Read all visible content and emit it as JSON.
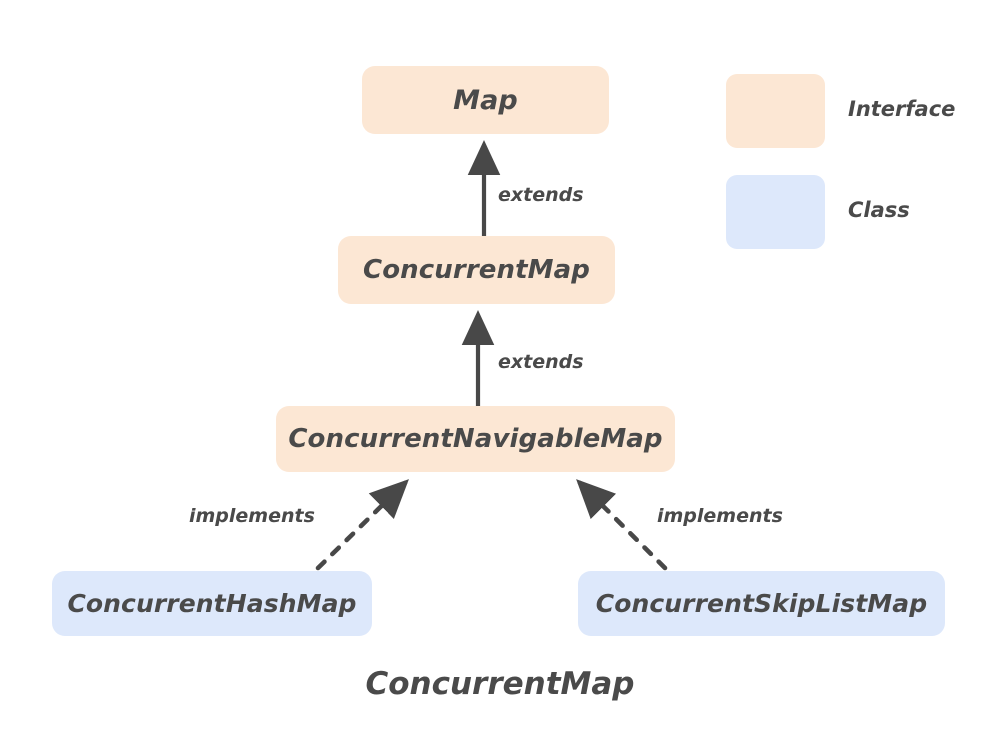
{
  "diagram": {
    "caption": "ConcurrentMap",
    "nodes": {
      "map": {
        "label": "Map",
        "kind": "Interface",
        "color": "#fce7d4"
      },
      "concurrent_map": {
        "label": "ConcurrentMap",
        "kind": "Interface",
        "color": "#fce7d4"
      },
      "concurrent_navigable_map": {
        "label": "ConcurrentNavigableMap",
        "kind": "Interface",
        "color": "#fce7d4"
      },
      "concurrent_hash_map": {
        "label": "ConcurrentHashMap",
        "kind": "Class",
        "color": "#dde8fb"
      },
      "concurrent_skip_list_map": {
        "label": "ConcurrentSkipListMap",
        "kind": "Class",
        "color": "#dde8fb"
      }
    },
    "edges": {
      "cmap_to_map": {
        "label": "extends",
        "style": "solid",
        "from": "ConcurrentMap",
        "to": "Map"
      },
      "cnav_to_cmap": {
        "label": "extends",
        "style": "solid",
        "from": "ConcurrentNavigableMap",
        "to": "ConcurrentMap"
      },
      "chash_to_cnav": {
        "label": "implements",
        "style": "dashed",
        "from": "ConcurrentHashMap",
        "to": "ConcurrentNavigableMap"
      },
      "cskip_to_cnav": {
        "label": "implements",
        "style": "dashed",
        "from": "ConcurrentSkipListMap",
        "to": "ConcurrentNavigableMap"
      }
    },
    "legend": {
      "interface": {
        "label": "Interface",
        "color": "#fce7d4"
      },
      "class": {
        "label": "Class",
        "color": "#dde8fb"
      }
    },
    "colors": {
      "interface_fill": "#fce7d4",
      "class_fill": "#dde8fb",
      "text": "#4a4a4a",
      "edge": "#484848",
      "background": "#ffffff"
    }
  }
}
